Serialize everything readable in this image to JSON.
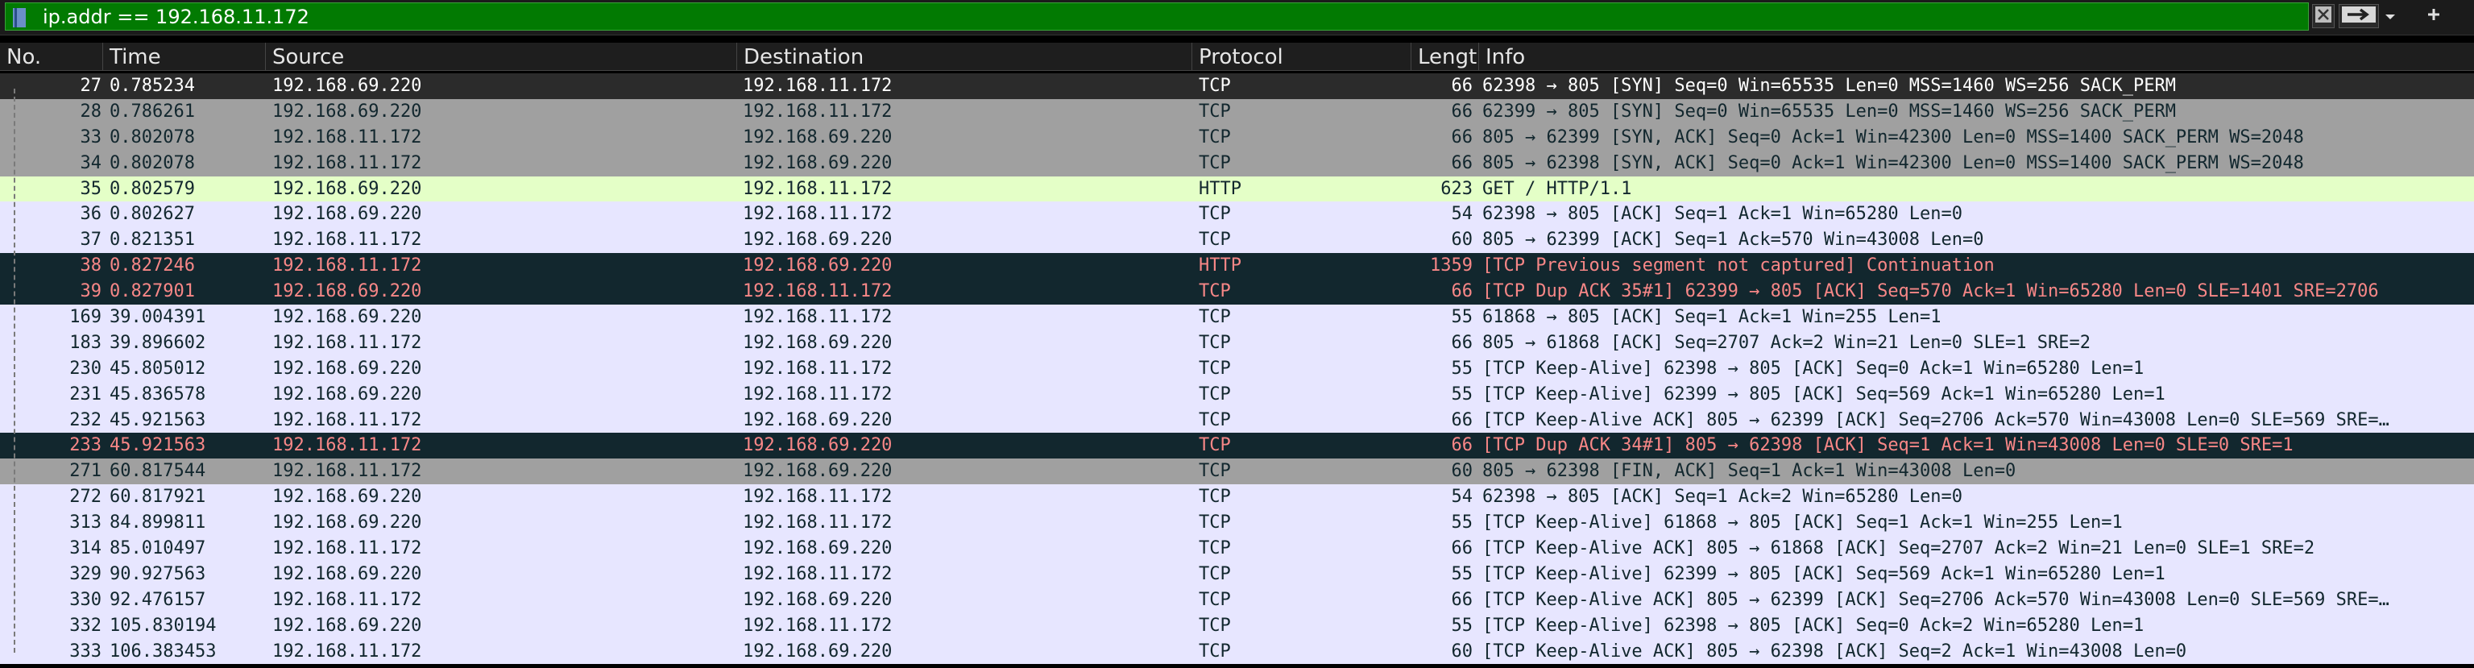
{
  "filter": {
    "value": "ip.addr == 192.168.11.172",
    "bg": "#027a02"
  },
  "columns": {
    "no": "No.",
    "time": "Time",
    "source": "Source",
    "destination": "Destination",
    "protocol": "Protocol",
    "length": "Length",
    "info": "Info"
  },
  "styles": {
    "selected": {
      "bg": "#2b2b2b",
      "fg": "#ffffff"
    },
    "tcp_gray": {
      "bg": "#a0a0a0",
      "fg": "#12272e"
    },
    "tcp_light": {
      "bg": "#e7e6ff",
      "fg": "#12272e"
    },
    "http": {
      "bg": "#e4ffc7",
      "fg": "#12272e"
    },
    "bad": {
      "bg": "#12272e",
      "fg": "#f78787"
    }
  },
  "packets": [
    {
      "no": "27",
      "time": "0.785234",
      "src": "192.168.69.220",
      "dst": "192.168.11.172",
      "proto": "TCP",
      "len": "66",
      "info": "62398 → 805 [SYN] Seq=0 Win=65535 Len=0 MSS=1460 WS=256 SACK_PERM",
      "style": "selected"
    },
    {
      "no": "28",
      "time": "0.786261",
      "src": "192.168.69.220",
      "dst": "192.168.11.172",
      "proto": "TCP",
      "len": "66",
      "info": "62399 → 805 [SYN] Seq=0 Win=65535 Len=0 MSS=1460 WS=256 SACK_PERM",
      "style": "tcp_gray"
    },
    {
      "no": "33",
      "time": "0.802078",
      "src": "192.168.11.172",
      "dst": "192.168.69.220",
      "proto": "TCP",
      "len": "66",
      "info": "805 → 62399 [SYN, ACK] Seq=0 Ack=1 Win=42300 Len=0 MSS=1400 SACK_PERM WS=2048",
      "style": "tcp_gray"
    },
    {
      "no": "34",
      "time": "0.802078",
      "src": "192.168.11.172",
      "dst": "192.168.69.220",
      "proto": "TCP",
      "len": "66",
      "info": "805 → 62398 [SYN, ACK] Seq=0 Ack=1 Win=42300 Len=0 MSS=1400 SACK_PERM WS=2048",
      "style": "tcp_gray"
    },
    {
      "no": "35",
      "time": "0.802579",
      "src": "192.168.69.220",
      "dst": "192.168.11.172",
      "proto": "HTTP",
      "len": "623",
      "info": "GET / HTTP/1.1",
      "style": "http"
    },
    {
      "no": "36",
      "time": "0.802627",
      "src": "192.168.69.220",
      "dst": "192.168.11.172",
      "proto": "TCP",
      "len": "54",
      "info": "62398 → 805 [ACK] Seq=1 Ack=1 Win=65280 Len=0",
      "style": "tcp_light"
    },
    {
      "no": "37",
      "time": "0.821351",
      "src": "192.168.11.172",
      "dst": "192.168.69.220",
      "proto": "TCP",
      "len": "60",
      "info": "805 → 62399 [ACK] Seq=1 Ack=570 Win=43008 Len=0",
      "style": "tcp_light"
    },
    {
      "no": "38",
      "time": "0.827246",
      "src": "192.168.11.172",
      "dst": "192.168.69.220",
      "proto": "HTTP",
      "len": "1359",
      "info": "[TCP Previous segment not captured] Continuation",
      "style": "bad"
    },
    {
      "no": "39",
      "time": "0.827901",
      "src": "192.168.69.220",
      "dst": "192.168.11.172",
      "proto": "TCP",
      "len": "66",
      "info": "[TCP Dup ACK 35#1] 62399 → 805 [ACK] Seq=570 Ack=1 Win=65280 Len=0 SLE=1401 SRE=2706",
      "style": "bad"
    },
    {
      "no": "169",
      "time": "39.004391",
      "src": "192.168.69.220",
      "dst": "192.168.11.172",
      "proto": "TCP",
      "len": "55",
      "info": "61868 → 805 [ACK] Seq=1 Ack=1 Win=255 Len=1",
      "style": "tcp_light"
    },
    {
      "no": "183",
      "time": "39.896602",
      "src": "192.168.11.172",
      "dst": "192.168.69.220",
      "proto": "TCP",
      "len": "66",
      "info": "805 → 61868 [ACK] Seq=2707 Ack=2 Win=21 Len=0 SLE=1 SRE=2",
      "style": "tcp_light"
    },
    {
      "no": "230",
      "time": "45.805012",
      "src": "192.168.69.220",
      "dst": "192.168.11.172",
      "proto": "TCP",
      "len": "55",
      "info": "[TCP Keep-Alive] 62398 → 805 [ACK] Seq=0 Ack=1 Win=65280 Len=1",
      "style": "tcp_light"
    },
    {
      "no": "231",
      "time": "45.836578",
      "src": "192.168.69.220",
      "dst": "192.168.11.172",
      "proto": "TCP",
      "len": "55",
      "info": "[TCP Keep-Alive] 62399 → 805 [ACK] Seq=569 Ack=1 Win=65280 Len=1",
      "style": "tcp_light"
    },
    {
      "no": "232",
      "time": "45.921563",
      "src": "192.168.11.172",
      "dst": "192.168.69.220",
      "proto": "TCP",
      "len": "66",
      "info": "[TCP Keep-Alive ACK] 805 → 62399 [ACK] Seq=2706 Ack=570 Win=43008 Len=0 SLE=569 SRE=…",
      "style": "tcp_light"
    },
    {
      "no": "233",
      "time": "45.921563",
      "src": "192.168.11.172",
      "dst": "192.168.69.220",
      "proto": "TCP",
      "len": "66",
      "info": "[TCP Dup ACK 34#1] 805 → 62398 [ACK] Seq=1 Ack=1 Win=43008 Len=0 SLE=0 SRE=1",
      "style": "bad"
    },
    {
      "no": "271",
      "time": "60.817544",
      "src": "192.168.11.172",
      "dst": "192.168.69.220",
      "proto": "TCP",
      "len": "60",
      "info": "805 → 62398 [FIN, ACK] Seq=1 Ack=1 Win=43008 Len=0",
      "style": "tcp_gray"
    },
    {
      "no": "272",
      "time": "60.817921",
      "src": "192.168.69.220",
      "dst": "192.168.11.172",
      "proto": "TCP",
      "len": "54",
      "info": "62398 → 805 [ACK] Seq=1 Ack=2 Win=65280 Len=0",
      "style": "tcp_light"
    },
    {
      "no": "313",
      "time": "84.899811",
      "src": "192.168.69.220",
      "dst": "192.168.11.172",
      "proto": "TCP",
      "len": "55",
      "info": "[TCP Keep-Alive] 61868 → 805 [ACK] Seq=1 Ack=1 Win=255 Len=1",
      "style": "tcp_light"
    },
    {
      "no": "314",
      "time": "85.010497",
      "src": "192.168.11.172",
      "dst": "192.168.69.220",
      "proto": "TCP",
      "len": "66",
      "info": "[TCP Keep-Alive ACK] 805 → 61868 [ACK] Seq=2707 Ack=2 Win=21 Len=0 SLE=1 SRE=2",
      "style": "tcp_light"
    },
    {
      "no": "329",
      "time": "90.927563",
      "src": "192.168.69.220",
      "dst": "192.168.11.172",
      "proto": "TCP",
      "len": "55",
      "info": "[TCP Keep-Alive] 62399 → 805 [ACK] Seq=569 Ack=1 Win=65280 Len=1",
      "style": "tcp_light"
    },
    {
      "no": "330",
      "time": "92.476157",
      "src": "192.168.11.172",
      "dst": "192.168.69.220",
      "proto": "TCP",
      "len": "66",
      "info": "[TCP Keep-Alive ACK] 805 → 62399 [ACK] Seq=2706 Ack=570 Win=43008 Len=0 SLE=569 SRE=…",
      "style": "tcp_light"
    },
    {
      "no": "332",
      "time": "105.830194",
      "src": "192.168.69.220",
      "dst": "192.168.11.172",
      "proto": "TCP",
      "len": "55",
      "info": "[TCP Keep-Alive] 62398 → 805 [ACK] Seq=0 Ack=2 Win=65280 Len=1",
      "style": "tcp_light"
    },
    {
      "no": "333",
      "time": "106.383453",
      "src": "192.168.11.172",
      "dst": "192.168.69.220",
      "proto": "TCP",
      "len": "60",
      "info": "[TCP Keep-Alive ACK] 805 → 62398 [ACK] Seq=2 Ack=1 Win=43008 Len=0",
      "style": "tcp_light"
    }
  ]
}
